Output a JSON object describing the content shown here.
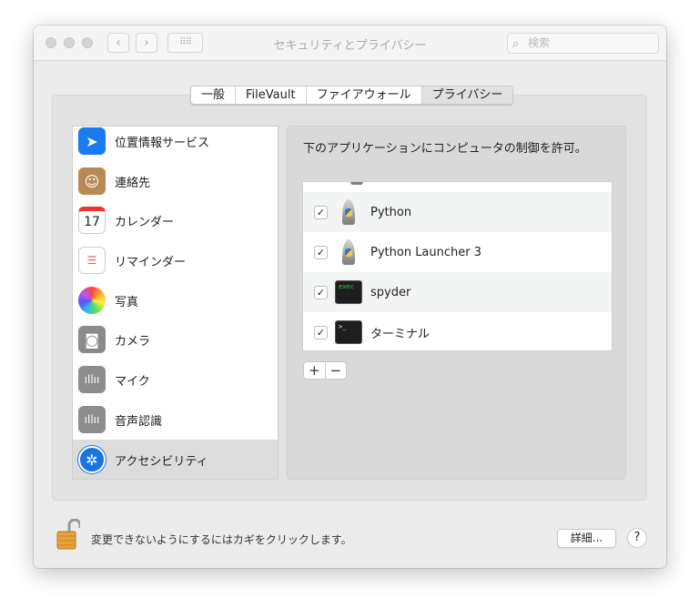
{
  "window": {
    "title": "セキュリティとプライバシー",
    "search_placeholder": "検索"
  },
  "tabs": [
    {
      "label": "一般"
    },
    {
      "label": "FileVault"
    },
    {
      "label": "ファイアウォール"
    },
    {
      "label": "プライバシー",
      "selected": true
    }
  ],
  "sidebar": {
    "items": [
      {
        "label": "位置情報サービス",
        "icon": "location-arrow-icon"
      },
      {
        "label": "連絡先",
        "icon": "contacts-icon"
      },
      {
        "label": "カレンダー",
        "icon": "calendar-icon",
        "icon_text": "17"
      },
      {
        "label": "リマインダー",
        "icon": "reminders-icon"
      },
      {
        "label": "写真",
        "icon": "photos-icon"
      },
      {
        "label": "カメラ",
        "icon": "camera-icon"
      },
      {
        "label": "マイク",
        "icon": "microphone-icon"
      },
      {
        "label": "音声認識",
        "icon": "speech-recognition-icon"
      },
      {
        "label": "アクセシビリティ",
        "icon": "accessibility-icon",
        "selected": true
      }
    ]
  },
  "main": {
    "description": "下のアプリケーションにコンピュータの制御を許可。",
    "apps": [
      {
        "name": "Python",
        "checked": true,
        "icon": "python-rocket-icon"
      },
      {
        "name": "Python Launcher 3",
        "checked": true,
        "icon": "python-rocket-icon"
      },
      {
        "name": "spyder",
        "checked": true,
        "icon": "exec-terminal-icon"
      },
      {
        "name": "ターミナル",
        "checked": true,
        "icon": "terminal-icon"
      }
    ],
    "add_label": "+",
    "remove_label": "−",
    "check": "✓"
  },
  "footer": {
    "lock_message": "変更できないようにするにはカギをクリックします。",
    "advanced_label": "詳細...",
    "help_label": "?"
  }
}
